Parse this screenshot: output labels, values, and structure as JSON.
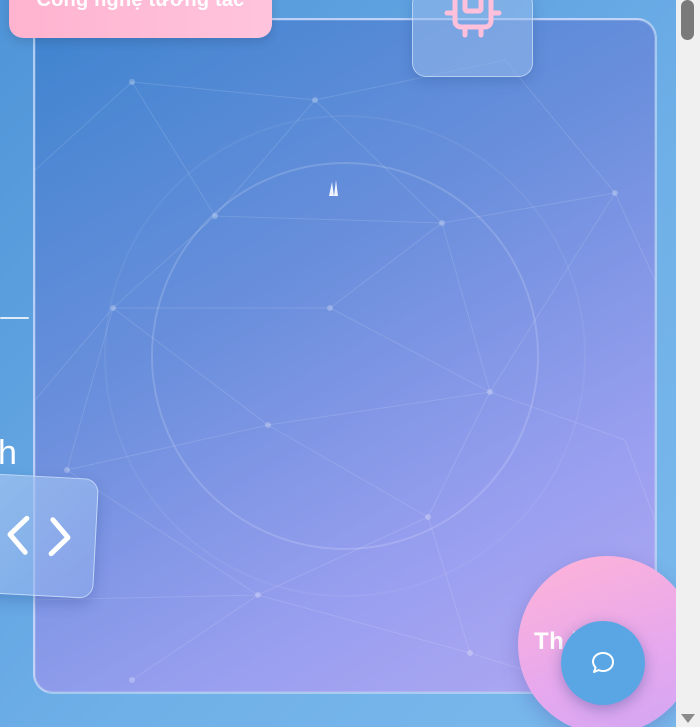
{
  "header": {
    "badge_label": "Công nghệ tương tác"
  },
  "side": {
    "partial_text": "h"
  },
  "floating": {
    "label": "Th   inh"
  },
  "icons": {
    "chip": "chip-icon",
    "code": "code-brackets-icon",
    "chat": "chat-bubble-icon",
    "sparkle": "sparkle-icon"
  },
  "colors": {
    "badge": "#ffb3cf",
    "chat_button": "#5aa6e4",
    "card_start": "#3f84cf",
    "card_end": "#b0a9f2",
    "blob": "#e6a8ee"
  }
}
